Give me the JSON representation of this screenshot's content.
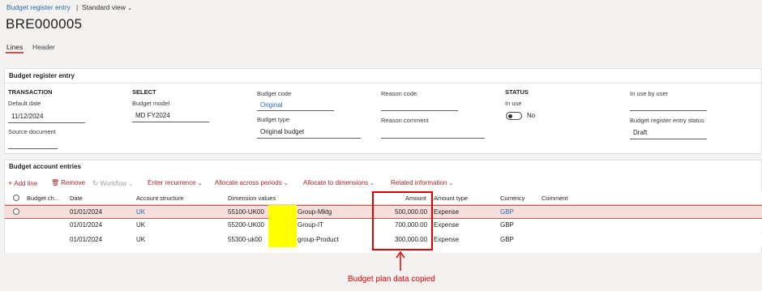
{
  "breadcrumb": {
    "link": "Budget register entry",
    "separator": "|",
    "view": "Standard view",
    "chevron_icon": "chevron-down-icon"
  },
  "page_title": "BRE000005",
  "tabs": [
    {
      "label": "Lines",
      "active": true
    },
    {
      "label": "Header",
      "active": false
    }
  ],
  "header_card": {
    "title": "Budget register entry",
    "transaction": {
      "heading": "TRANSACTION",
      "default_date_label": "Default date",
      "default_date_value": "11/12/2024",
      "source_document_label": "Source document",
      "source_document_value": ""
    },
    "select": {
      "heading": "SELECT",
      "budget_model_label": "Budget model",
      "budget_model_value": "MD FY2024"
    },
    "budget": {
      "budget_code_label": "Budget code",
      "budget_code_value": "Original",
      "budget_type_label": "Budget type",
      "budget_type_value": "Original budget"
    },
    "reason": {
      "reason_code_label": "Reason code",
      "reason_code_value": "",
      "reason_comment_label": "Reason comment",
      "reason_comment_value": ""
    },
    "status": {
      "heading": "STATUS",
      "in_use_label": "In use",
      "in_use_value": "No",
      "in_use_on": false
    },
    "user": {
      "in_use_by_label": "In use by user",
      "in_use_by_value": "",
      "entry_status_label": "Budget register entry status",
      "entry_status_value": "Draft"
    }
  },
  "entries": {
    "title": "Budget account entries",
    "actions": {
      "add_line": "Add line",
      "remove": "Remove",
      "workflow": "Workflow",
      "enter_recurrence": "Enter recurrence",
      "allocate_periods": "Allocate across periods",
      "allocate_dimensions": "Allocate to dimensions",
      "related_information": "Related information"
    },
    "columns": {
      "budget_ch": "Budget ch...",
      "date": "Date",
      "account_structure": "Account structure",
      "dimension_values": "Dimension values",
      "amount": "Amount",
      "amount_type": "Amount type",
      "currency": "Currency",
      "comment": "Comment"
    },
    "rows": [
      {
        "date": "01/01/2024",
        "account_structure": "UK",
        "dim_prefix": "55100-UK00",
        "dim_suffix": "Group-Mktg",
        "amount": "500,000.00",
        "amount_type": "Expense",
        "currency": "GBP",
        "selected": true
      },
      {
        "date": "01/01/2024",
        "account_structure": "UK",
        "dim_prefix": "55200-UK00",
        "dim_suffix": "Group-IT",
        "amount": "700,000.00",
        "amount_type": "Expense",
        "currency": "GBP",
        "selected": false
      },
      {
        "date": "01/01/2024",
        "account_structure": "UK",
        "dim_prefix": "55300-uk00",
        "dim_suffix": "group-Product",
        "amount": "300,000.00",
        "amount_type": "Expense",
        "currency": "GBP",
        "selected": false
      }
    ]
  },
  "annotation": {
    "text": "Budget plan data  copied",
    "color": "#e00000",
    "mask_color": "#ffff00"
  },
  "colors": {
    "accent": "#c7554b",
    "link": "#2b6cb0",
    "selected_row": "#f6dedc"
  }
}
